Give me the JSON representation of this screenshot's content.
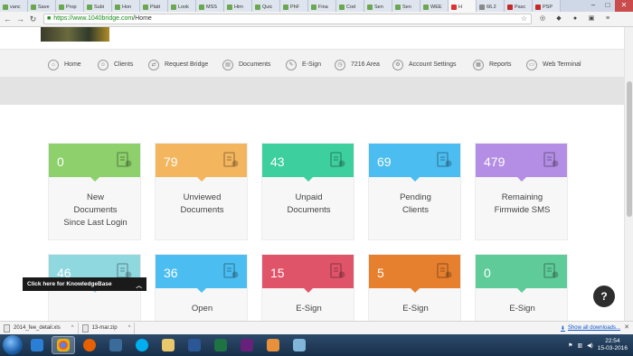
{
  "browser": {
    "tabs": [
      {
        "label": "vanc"
      },
      {
        "label": "Save"
      },
      {
        "label": "Prop"
      },
      {
        "label": "Subi"
      },
      {
        "label": "Hon"
      },
      {
        "label": "Platt"
      },
      {
        "label": "Look"
      },
      {
        "label": "MSS"
      },
      {
        "label": "Him"
      },
      {
        "label": "Quic"
      },
      {
        "label": "PhF"
      },
      {
        "label": "Fina"
      },
      {
        "label": "Cod"
      },
      {
        "label": "Sen"
      },
      {
        "label": "Sen"
      },
      {
        "label": "WEE"
      },
      {
        "label": "H"
      },
      {
        "label": "66.2"
      },
      {
        "label": "Pasc"
      },
      {
        "label": "PSP"
      }
    ],
    "url_host": "https://www.1040bridge.com",
    "url_path": "/Home"
  },
  "nav": {
    "items": [
      {
        "label": "Home",
        "icon": "home-icon"
      },
      {
        "label": "Clients",
        "icon": "clients-icon"
      },
      {
        "label": "Request Bridge",
        "icon": "request-bridge-icon"
      },
      {
        "label": "Documents",
        "icon": "documents-icon"
      },
      {
        "label": "E-Sign",
        "icon": "esign-icon"
      },
      {
        "label": "7216 Area",
        "icon": "area-icon"
      },
      {
        "label": "Account Settings",
        "icon": "account-settings-icon"
      },
      {
        "label": "Reports",
        "icon": "reports-icon"
      },
      {
        "label": "Web Terminal",
        "icon": "web-terminal-icon"
      }
    ]
  },
  "cards": [
    {
      "value": "0",
      "label": "New Documents Since Last Login",
      "color": "#8dd06c",
      "icon": "download-doc-icon"
    },
    {
      "value": "79",
      "label": "Unviewed Documents",
      "color": "#f3b65e",
      "icon": "doc-hand-icon"
    },
    {
      "value": "43",
      "label": "Unpaid Documents",
      "color": "#3ecf9e",
      "icon": "doc-dollar-icon"
    },
    {
      "value": "69",
      "label": "Pending Clients",
      "color": "#4bbdf0",
      "icon": "users-icon"
    },
    {
      "value": "479",
      "label": "Remaining Firmwide SMS",
      "color": "#b48ee4",
      "icon": "chat-icon"
    },
    {
      "value": "46",
      "label": "",
      "color": "#8fd8e0",
      "icon": "service-bell-icon"
    },
    {
      "value": "36",
      "label": "Open",
      "color": "#4bbdf0",
      "icon": "umbrella-stand-icon"
    },
    {
      "value": "15",
      "label": "E-Sign",
      "color": "#e0546a",
      "icon": "doc-pen-icon"
    },
    {
      "value": "5",
      "label": "E-Sign",
      "color": "#e6802e",
      "icon": "doc-sign-icon"
    },
    {
      "value": "0",
      "label": "E-Sign",
      "color": "#5fcb99",
      "icon": "doc-page-icon"
    }
  ],
  "knowledgebase_label": "Click here for KnowledgeBase",
  "downloads": [
    {
      "name": "2014_fee_detail.xls"
    },
    {
      "name": "13-mar.zip"
    }
  ],
  "show_all_downloads": "Show all downloads...",
  "clock": {
    "time": "22:54",
    "date": "15-03-2016"
  }
}
